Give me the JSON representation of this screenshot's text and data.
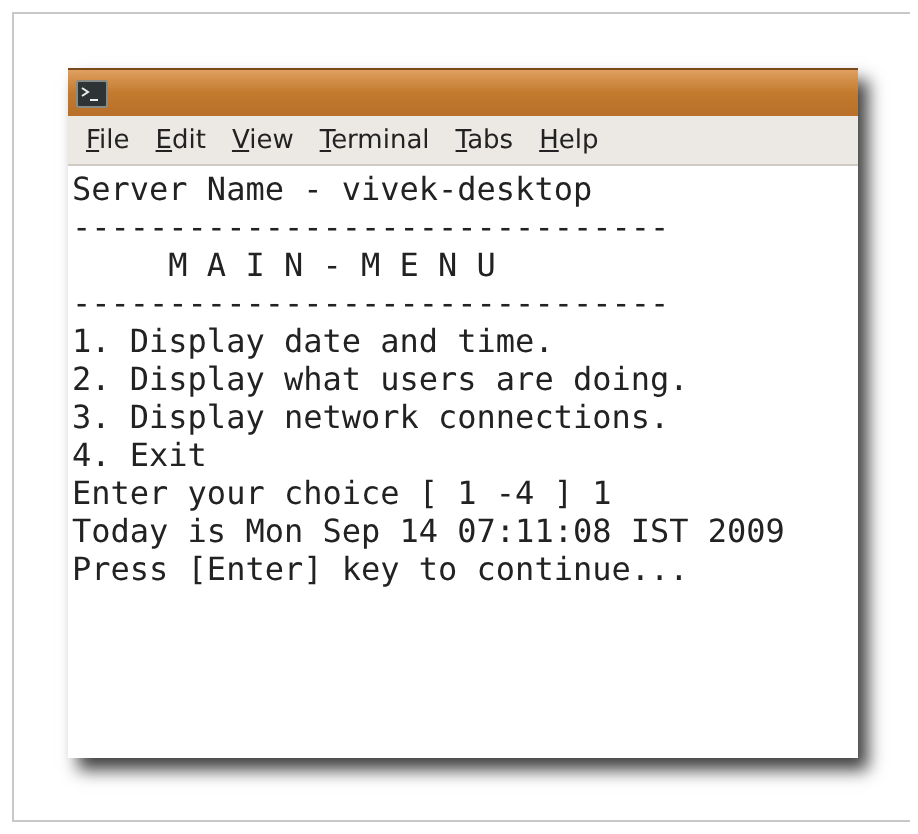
{
  "menu": [
    "File",
    "Edit",
    "View",
    "Terminal",
    "Tabs",
    "Help"
  ],
  "terminal_lines": [
    "Server Name - vivek-desktop",
    "-------------------------------",
    "     M A I N - M E N U",
    "-------------------------------",
    "1. Display date and time.",
    "2. Display what users are doing.",
    "3. Display network connections.",
    "4. Exit",
    "Enter your choice [ 1 -4 ] 1",
    "Today is Mon Sep 14 07:11:08 IST 2009",
    "Press [Enter] key to continue..."
  ]
}
